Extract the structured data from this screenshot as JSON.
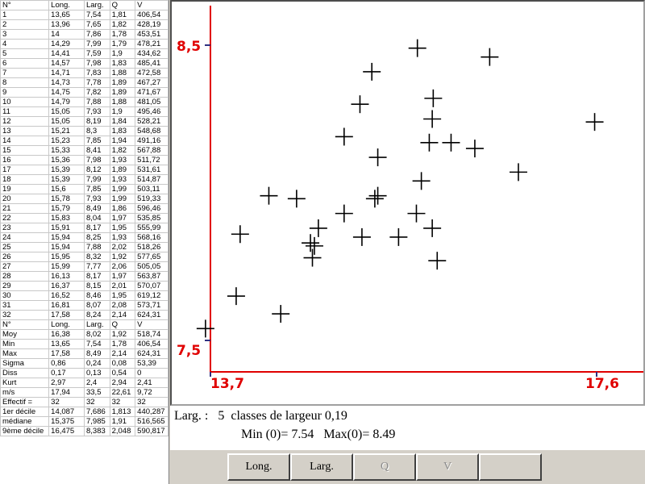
{
  "grid": {
    "header": [
      "N°",
      "Long.",
      "Larg.",
      "Q",
      "V"
    ],
    "rows": [
      [
        "1",
        "13,65",
        "7,54",
        "1,81",
        "406,54"
      ],
      [
        "2",
        "13,96",
        "7,65",
        "1,82",
        "428,19"
      ],
      [
        "3",
        "14",
        "7,86",
        "1,78",
        "453,51"
      ],
      [
        "4",
        "14,29",
        "7,99",
        "1,79",
        "478,21"
      ],
      [
        "5",
        "14,41",
        "7,59",
        "1,9",
        "434,62"
      ],
      [
        "6",
        "14,57",
        "7,98",
        "1,83",
        "485,41"
      ],
      [
        "7",
        "14,71",
        "7,83",
        "1,88",
        "472,58"
      ],
      [
        "8",
        "14,73",
        "7,78",
        "1,89",
        "467,27"
      ],
      [
        "9",
        "14,75",
        "7,82",
        "1,89",
        "471,67"
      ],
      [
        "10",
        "14,79",
        "7,88",
        "1,88",
        "481,05"
      ],
      [
        "11",
        "15,05",
        "7,93",
        "1,9",
        "495,46"
      ],
      [
        "12",
        "15,05",
        "8,19",
        "1,84",
        "528,21"
      ],
      [
        "13",
        "15,21",
        "8,3",
        "1,83",
        "548,68"
      ],
      [
        "14",
        "15,23",
        "7,85",
        "1,94",
        "491,16"
      ],
      [
        "15",
        "15,33",
        "8,41",
        "1,82",
        "567,88"
      ],
      [
        "16",
        "15,36",
        "7,98",
        "1,93",
        "511,72"
      ],
      [
        "17",
        "15,39",
        "8,12",
        "1,89",
        "531,61"
      ],
      [
        "18",
        "15,39",
        "7,99",
        "1,93",
        "514,87"
      ],
      [
        "19",
        "15,6",
        "7,85",
        "1,99",
        "503,11"
      ],
      [
        "20",
        "15,78",
        "7,93",
        "1,99",
        "519,33"
      ],
      [
        "21",
        "15,79",
        "8,49",
        "1,86",
        "596,46"
      ],
      [
        "22",
        "15,83",
        "8,04",
        "1,97",
        "535,85"
      ],
      [
        "23",
        "15,91",
        "8,17",
        "1,95",
        "555,99"
      ],
      [
        "24",
        "15,94",
        "8,25",
        "1,93",
        "568,16"
      ],
      [
        "25",
        "15,94",
        "7,88",
        "2,02",
        "518,26"
      ],
      [
        "26",
        "15,95",
        "8,32",
        "1,92",
        "577,65"
      ],
      [
        "27",
        "15,99",
        "7,77",
        "2,06",
        "505,05"
      ],
      [
        "28",
        "16,13",
        "8,17",
        "1,97",
        "563,87"
      ],
      [
        "29",
        "16,37",
        "8,15",
        "2,01",
        "570,07"
      ],
      [
        "30",
        "16,52",
        "8,46",
        "1,95",
        "619,12"
      ],
      [
        "31",
        "16,81",
        "8,07",
        "2,08",
        "573,71"
      ],
      [
        "32",
        "17,58",
        "8,24",
        "2,14",
        "624,31"
      ]
    ],
    "stats_header": [
      "N°",
      "Long.",
      "Larg.",
      "Q",
      "V"
    ],
    "stats": [
      [
        "Moy",
        "16,38",
        "8,02",
        "1,92",
        "518,74"
      ],
      [
        "Min",
        "13,65",
        "7,54",
        "1,78",
        "406,54"
      ],
      [
        "Max",
        "17,58",
        "8,49",
        "2,14",
        "624,31"
      ],
      [
        "Sigma",
        "0,86",
        "0,24",
        "0,08",
        "53,39"
      ],
      [
        "Diss",
        "0,17",
        "0,13",
        "0,54",
        "0"
      ],
      [
        "Kurt",
        "2,97",
        "2,4",
        "2,94",
        "2,41"
      ],
      [
        "m/s",
        "17,94",
        "33,5",
        "22,61",
        "9,72"
      ],
      [
        "Effectif =",
        "32",
        "32",
        "32",
        "32"
      ],
      [
        "1er décile",
        "14,087",
        "7,686",
        "1,813",
        "440,287"
      ],
      [
        "médiane",
        "15,375",
        "7,985",
        "1,91",
        "516,565"
      ],
      [
        "9ème décile",
        "16,475",
        "8,383",
        "2,048",
        "590,817"
      ]
    ]
  },
  "chart_data": {
    "type": "scatter",
    "x": [
      13.65,
      13.96,
      14,
      14.29,
      14.41,
      14.57,
      14.71,
      14.73,
      14.75,
      14.79,
      15.05,
      15.05,
      15.21,
      15.23,
      15.33,
      15.36,
      15.39,
      15.39,
      15.6,
      15.78,
      15.79,
      15.83,
      15.91,
      15.94,
      15.94,
      15.95,
      15.99,
      16.13,
      16.37,
      16.52,
      16.81,
      17.58
    ],
    "y": [
      7.54,
      7.65,
      7.86,
      7.99,
      7.59,
      7.98,
      7.83,
      7.78,
      7.82,
      7.88,
      7.93,
      8.19,
      8.3,
      7.85,
      8.41,
      7.98,
      8.12,
      7.99,
      7.85,
      7.93,
      8.49,
      8.04,
      8.17,
      8.25,
      7.88,
      8.32,
      7.77,
      8.17,
      8.15,
      8.46,
      8.07,
      8.24
    ],
    "xlim": [
      13.7,
      17.6
    ],
    "ylim": [
      7.5,
      8.5
    ],
    "x_tick_labels": [
      "13,7",
      "17,6"
    ],
    "y_tick_labels": [
      "8,5",
      "7,5"
    ],
    "marker": "plus",
    "grid": false,
    "axis_color": "#e00000",
    "marker_color": "#000000"
  },
  "info": {
    "line1": "Larg. :   5  classes de largeur 0,19",
    "line2": "Min (0)= 7.54   Max(0)= 8.49"
  },
  "buttons": {
    "long": "Long.",
    "larg": "Larg.",
    "q": "Q",
    "v": "V",
    "blank": ""
  }
}
